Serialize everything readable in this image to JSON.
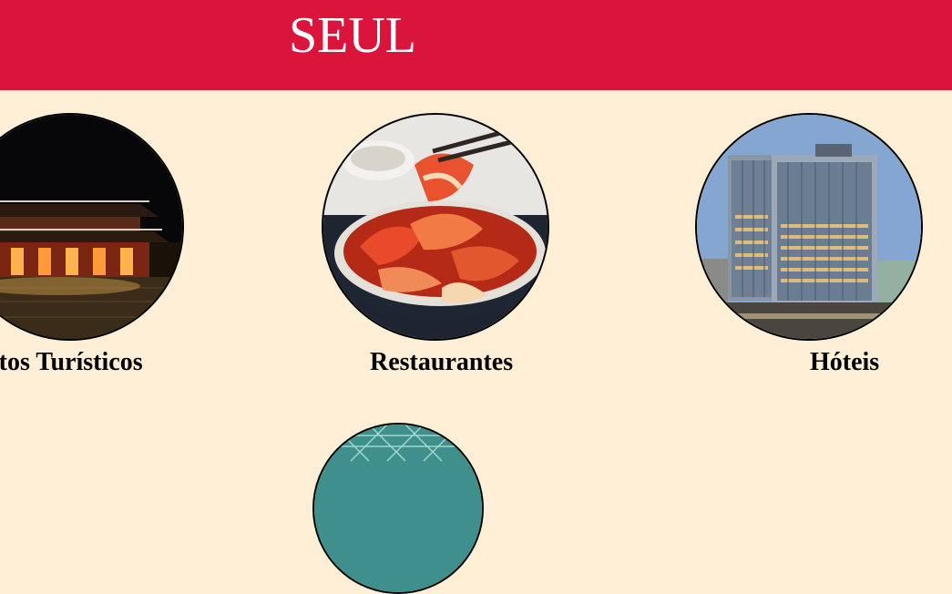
{
  "header": {
    "title": "SEUL",
    "background_color": "#db143c"
  },
  "page": {
    "background_color": "#feefd6"
  },
  "cards": [
    {
      "label": "Pontos Turísticos",
      "image": "palace-at-night"
    },
    {
      "label": "Restaurantes",
      "image": "kimchi-bowl"
    },
    {
      "label": "Hóteis",
      "image": "hotel-towers"
    }
  ],
  "next_card": {
    "image": "glass-dome-building"
  }
}
